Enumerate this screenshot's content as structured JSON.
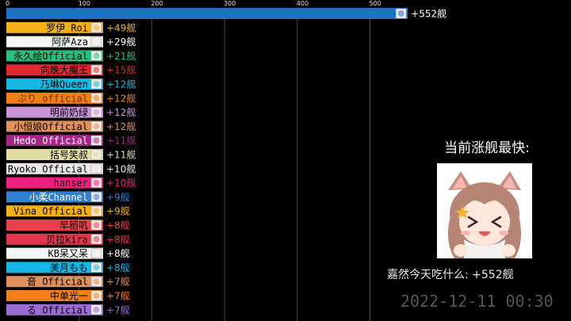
{
  "chart_data": {
    "type": "bar",
    "orientation": "horizontal",
    "xlim": [
      0,
      600
    ],
    "ticks": [
      0,
      100,
      200,
      300,
      400,
      500
    ],
    "categories": [
      "嘉然今天吃什么",
      "罗伊 Roi",
      "阿萨Aza",
      "永久绘Official",
      "向晚大魔王",
      "乃琳Queen",
      "ぷり official",
      "明前奶绿",
      "小恒娘Official",
      "Hedo Official",
      "括号笑叔",
      "Ryoko Official",
      "hanser",
      "小柔Channel",
      "Vina Official",
      "早稻叽",
      "贝拉kira",
      "KB呆又呆",
      "美月もも",
      "音 Official",
      "中单光一",
      "る Official"
    ],
    "values": [
      552,
      49,
      29,
      21,
      15,
      12,
      12,
      12,
      12,
      11,
      11,
      10,
      10,
      9,
      9,
      8,
      8,
      8,
      8,
      7,
      7,
      7
    ],
    "value_labels": [
      "+552舰",
      "+49舰",
      "+29舰",
      "+21舰",
      "+15舰",
      "+12舰",
      "+12舰",
      "+12舰",
      "+12舰",
      "+11舰",
      "+11舰",
      "+10舰",
      "+10舰",
      "+9舰",
      "+9舰",
      "+8舰",
      "+8舰",
      "+8舰",
      "+8舰",
      "+7舰",
      "+7舰",
      "+7舰"
    ],
    "colors": [
      "#1e73c8",
      "#f5b014",
      "#f5f5f5",
      "#26c07a",
      "#e02830",
      "#16b8e6",
      "#f07f17",
      "#c993d9",
      "#e0905a",
      "#a8238a",
      "#e0dca2",
      "#e8e8e8",
      "#ef2081",
      "#2f80d0",
      "#f5b014",
      "#e8404a",
      "#e03650",
      "#f5f5f5",
      "#16b8e6",
      "#e0905a",
      "#f07f17",
      "#9b6cd4"
    ],
    "label_colors": [
      "#1e73c8",
      "#000000",
      "#000000",
      "#000000",
      "#000000",
      "#000000",
      "#7a2a00",
      "#000000",
      "#000000",
      "#ffffff",
      "#000000",
      "#000000",
      "#000000",
      "#ffffff",
      "#000000",
      "#000000",
      "#000000",
      "#000000",
      "#000000",
      "#000000",
      "#000000",
      "#000000"
    ],
    "value_colors": [
      "#ffffff",
      "#f5b014",
      "#ffffff",
      "#26c07a",
      "#e02830",
      "#16b8e6",
      "#f07f17",
      "#c993d9",
      "#e0905a",
      "#a8238a",
      "#e0dca2",
      "#e8e8e8",
      "#ef2081",
      "#2f80d0",
      "#f5b014",
      "#e8404a",
      "#e03650",
      "#ffffff",
      "#16b8e6",
      "#e0905a",
      "#f07f17",
      "#9b6cd4"
    ]
  },
  "sidebar": {
    "title": "当前涨舰最快:",
    "caption": "嘉然今天吃什么: +552舰"
  },
  "date": "2022-12-11 00:30"
}
